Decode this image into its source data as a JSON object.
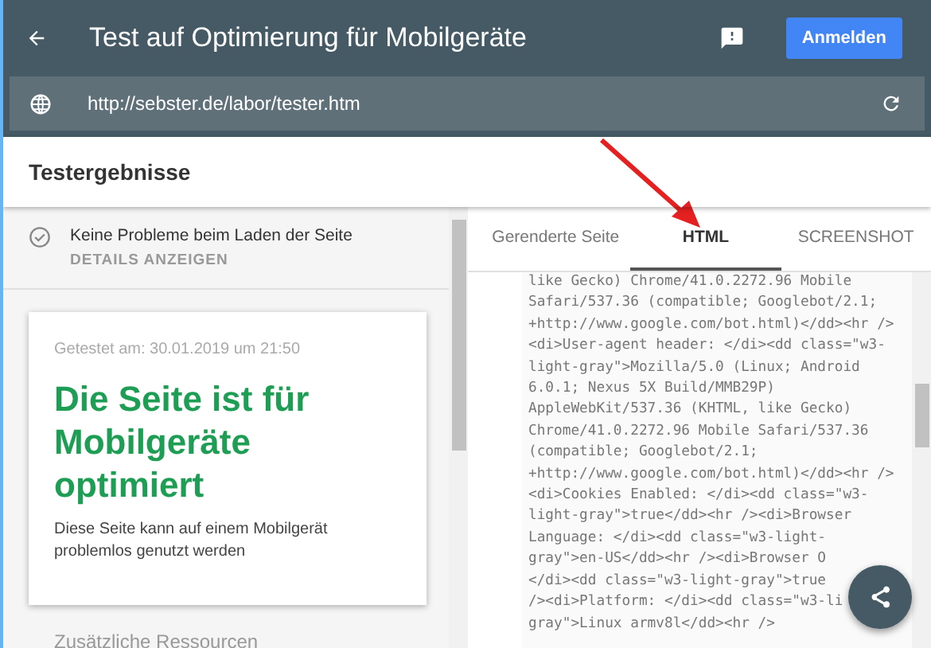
{
  "header": {
    "title": "Test auf Optimierung für Mobilgeräte",
    "login_button": "Anmelden"
  },
  "url_bar": {
    "value": "http://sebster.de/labor/tester.htm"
  },
  "section_title": "Testergebnisse",
  "status": {
    "text": "Keine Probleme beim Laden der Seite",
    "link": "DETAILS ANZEIGEN"
  },
  "result_card": {
    "tested": "Getestet am: 30.01.2019 um 21:50",
    "headline": "Die Seite ist für Mobilgeräte optimiert",
    "description": "Diese Seite kann auf einem Mobilgerät problemlos genutzt werden"
  },
  "resources_title": "Zusätzliche Ressourcen",
  "tabs": [
    {
      "label": "Gerenderte Seite",
      "selected": false
    },
    {
      "label": "HTML",
      "selected": true
    },
    {
      "label": "SCREENSHOT",
      "selected": false
    }
  ],
  "code_lines": [
    "like Gecko) Chrome/41.0.2272.96 Mobile",
    "Safari/537.36 (compatible; Googlebot/2.1;",
    "+http://www.google.com/bot.html)</dd><hr />",
    "<di>User-agent header: </di><dd class=\"w3-",
    "light-gray\">Mozilla/5.0 (Linux; Android",
    "6.0.1; Nexus 5X Build/MMB29P)",
    "AppleWebKit/537.36 (KHTML, like Gecko)",
    "Chrome/41.0.2272.96 Mobile Safari/537.36",
    "(compatible; Googlebot/2.1;",
    "+http://www.google.com/bot.html)</dd><hr />",
    "<di>Cookies Enabled: </di><dd class=\"w3-",
    "light-gray\">true</dd><hr /><di>Browser",
    "Language: </di><dd class=\"w3-light-",
    "gray\">en-US</dd><hr /><di>Browser O",
    "</di><dd class=\"w3-light-gray\">true",
    "/><di>Platform: </di><dd class=\"w3-li",
    "gray\">Linux armv8l</dd><hr />"
  ]
}
